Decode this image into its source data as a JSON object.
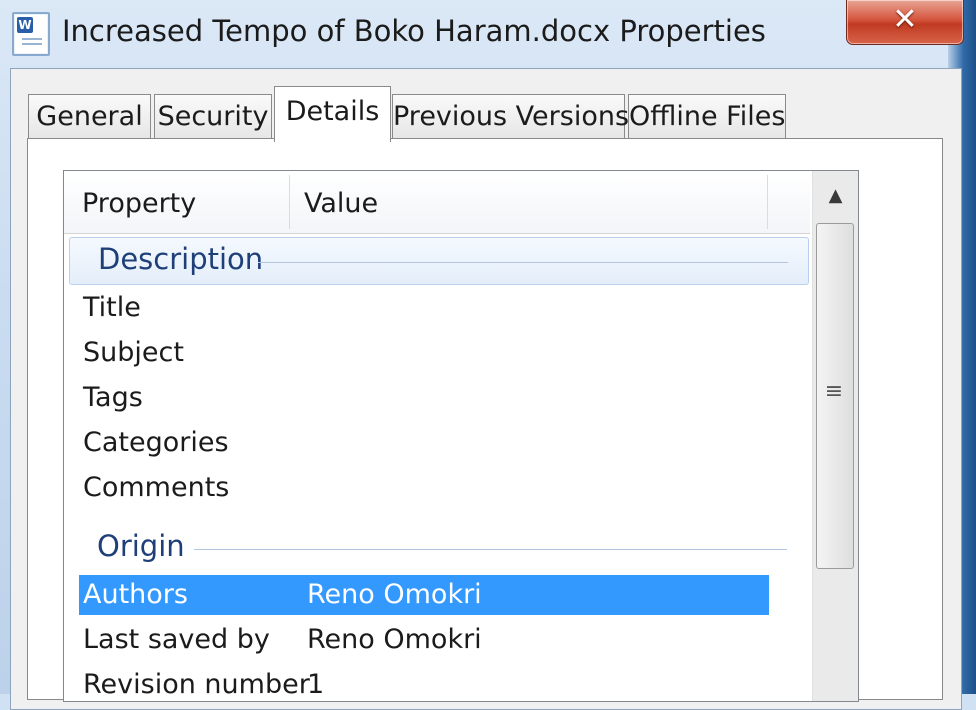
{
  "window": {
    "title": "Increased Tempo of Boko Haram.docx Properties",
    "app_icon": "word-document-icon",
    "close_glyph": "✕"
  },
  "tabs": [
    {
      "label": "General",
      "active": false
    },
    {
      "label": "Security",
      "active": false
    },
    {
      "label": "Details",
      "active": true
    },
    {
      "label": "Previous Versions",
      "active": false
    },
    {
      "label": "Offline Files",
      "active": false
    }
  ],
  "list": {
    "columns": {
      "property": "Property",
      "value": "Value"
    },
    "groups": [
      {
        "label": "Description",
        "rows": [
          {
            "property": "Title",
            "value": ""
          },
          {
            "property": "Subject",
            "value": ""
          },
          {
            "property": "Tags",
            "value": ""
          },
          {
            "property": "Categories",
            "value": ""
          },
          {
            "property": "Comments",
            "value": ""
          }
        ]
      },
      {
        "label": "Origin",
        "rows": [
          {
            "property": "Authors",
            "value": "Reno Omokri",
            "selected": true
          },
          {
            "property": "Last saved by",
            "value": "Reno Omokri"
          },
          {
            "property": "Revision number",
            "value": "1"
          }
        ]
      }
    ]
  },
  "scrollbar": {
    "up_glyph": "▲",
    "grip_glyph": "≡"
  },
  "colors": {
    "selection": "#3399ff",
    "group_label": "#1e3f78",
    "close_button": "#c9452d"
  }
}
